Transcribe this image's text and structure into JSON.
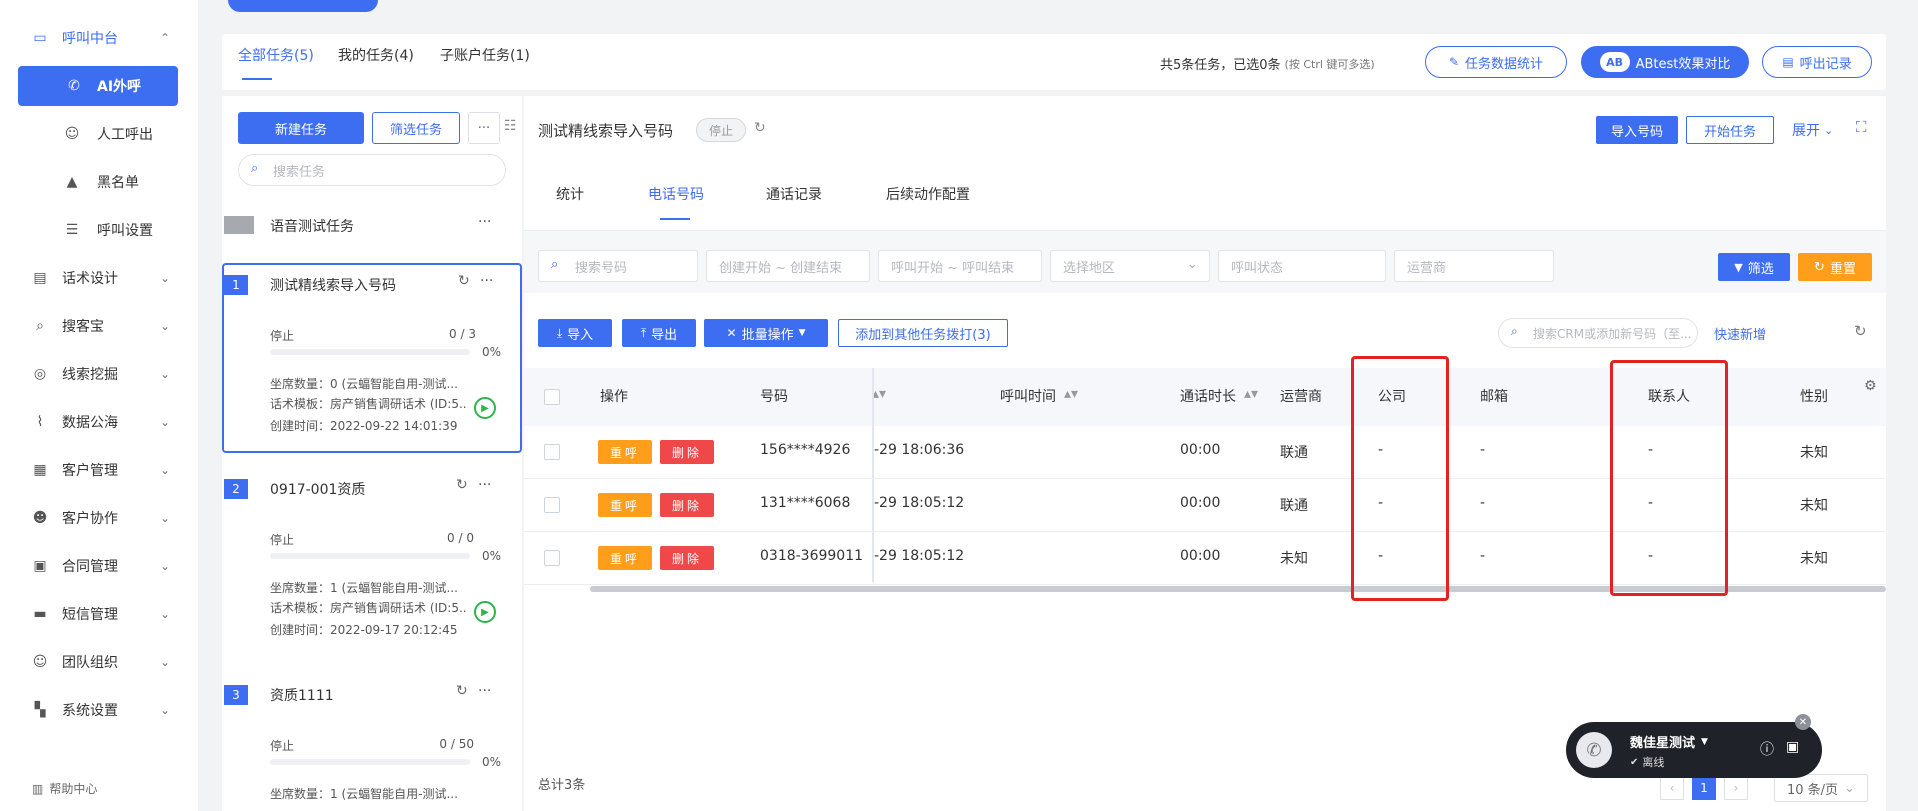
{
  "sidebar": {
    "items": [
      {
        "label": "呼叫中台",
        "icon": "monitor-icon"
      },
      {
        "label": "AI外呼",
        "icon": "phone-icon"
      },
      {
        "label": "人工呼出",
        "icon": "user-icon"
      },
      {
        "label": "黑名单",
        "icon": "warning-icon"
      },
      {
        "label": "呼叫设置",
        "icon": "sliders-icon"
      },
      {
        "label": "话术设计",
        "icon": "document-icon"
      },
      {
        "label": "搜客宝",
        "icon": "search-icon"
      },
      {
        "label": "线索挖掘",
        "icon": "target-icon"
      },
      {
        "label": "数据公海",
        "icon": "chart-icon"
      },
      {
        "label": "客户管理",
        "icon": "contacts-icon"
      },
      {
        "label": "客户协作",
        "icon": "team-icon"
      },
      {
        "label": "合同管理",
        "icon": "contract-icon"
      },
      {
        "label": "短信管理",
        "icon": "message-icon"
      },
      {
        "label": "团队组织",
        "icon": "group-icon"
      },
      {
        "label": "系统设置",
        "icon": "grid-icon"
      }
    ],
    "help": "帮助中心"
  },
  "top_tabs": {
    "all": "全部任务(5)",
    "mine": "我的任务(4)",
    "sub": "子账户任务(1)",
    "summary_prefix": "共5条任务，已选0条",
    "summary_hint": "(按 Ctrl 键可多选)",
    "stats_btn": "任务数据统计",
    "ab_btn": "ABtest效果对比",
    "ab_mark": "AB",
    "records_btn": "呼出记录"
  },
  "tasklist": {
    "new_btn": "新建任务",
    "filter_btn": "筛选任务",
    "more": "···",
    "search_placeholder": "搜索任务",
    "group_title": "语音测试任务",
    "tasks": [
      {
        "num": "1",
        "title": "测试精线索导入号码",
        "status": "停止",
        "progress": "0 / 3",
        "pct": "0%",
        "seats": "坐席数量：0 (云蝠智能自用-测试...",
        "script": "话术模板：房产销售调研话术 (ID:5...",
        "created": "创建时间：2022-09-22 14:01:39"
      },
      {
        "num": "2",
        "title": "0917-001资质",
        "status": "停止",
        "progress": "0 / 0",
        "pct": "0%",
        "seats": "坐席数量：1 (云蝠智能自用-测试...",
        "script": "话术模板：房产销售调研话术 (ID:5...",
        "created": "创建时间：2022-09-17 20:12:45"
      },
      {
        "num": "3",
        "title": "资质1111",
        "status": "停止",
        "progress": "0 / 50",
        "pct": "0%",
        "seats": "坐席数量：1 (云蝠智能自用-测试..."
      }
    ]
  },
  "detail": {
    "title": "测试精线索导入号码",
    "status_badge": "停止",
    "import_btn": "导入号码",
    "start_btn": "开始任务",
    "expand": "展开",
    "tabs": [
      "统计",
      "电话号码",
      "通话记录",
      "后续动作配置"
    ],
    "filters": {
      "search_number": "搜索号码",
      "create_range": "创建开始 ~ 创建结束",
      "call_range": "呼叫开始 ~ 呼叫结束",
      "region": "选择地区",
      "call_status": "呼叫状态",
      "carrier": "运营商",
      "filter_btn": "筛选",
      "reset_btn": "重置"
    },
    "actions": {
      "import": "导入",
      "export": "导出",
      "batch": "批量操作",
      "add_to_task": "添加到其他任务拨打(3)",
      "crm_search": "搜索CRM或添加新号码（至...",
      "quick_add": "快速新增"
    },
    "columns": [
      "操作",
      "号码",
      "呼叫时间",
      "通话时长",
      "运营商",
      "公司",
      "邮箱",
      "联系人",
      "性别"
    ],
    "btn_recall": "重呼",
    "btn_delete": "删除",
    "rows": [
      {
        "number": "156****4926",
        "time": "-29 18:06:36",
        "duration": "00:00",
        "carrier": "联通",
        "company": "-",
        "email": "-",
        "contact": "-",
        "gender": "未知"
      },
      {
        "number": "131****6068",
        "time": "-29 18:05:12",
        "duration": "00:00",
        "carrier": "联通",
        "company": "-",
        "email": "-",
        "contact": "-",
        "gender": "未知"
      },
      {
        "number": "0318-3699011",
        "time": "-29 18:05:12",
        "duration": "00:00",
        "carrier": "未知",
        "company": "-",
        "email": "-",
        "contact": "-",
        "gender": "未知"
      }
    ],
    "total": "总计3条",
    "page": "1",
    "page_size": "10 条/页"
  },
  "phone_widget": {
    "name": "魏佳星测试",
    "status": "离线"
  }
}
